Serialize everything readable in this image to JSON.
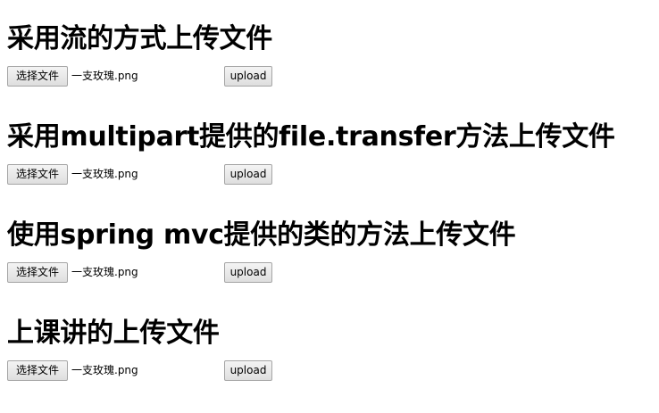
{
  "sections": [
    {
      "heading": "采用流的方式上传文件",
      "choose_file_label": "选择文件",
      "file_name": "一支玫瑰.png",
      "upload_label": "upload"
    },
    {
      "heading": "采用multipart提供的file.transfer方法上传文件",
      "choose_file_label": "选择文件",
      "file_name": "一支玫瑰.png",
      "upload_label": "upload"
    },
    {
      "heading": "使用spring mvc提供的类的方法上传文件",
      "choose_file_label": "选择文件",
      "file_name": "一支玫瑰.png",
      "upload_label": "upload"
    },
    {
      "heading": "上课讲的上传文件",
      "choose_file_label": "选择文件",
      "file_name": "一支玫瑰.png",
      "upload_label": "upload"
    }
  ]
}
